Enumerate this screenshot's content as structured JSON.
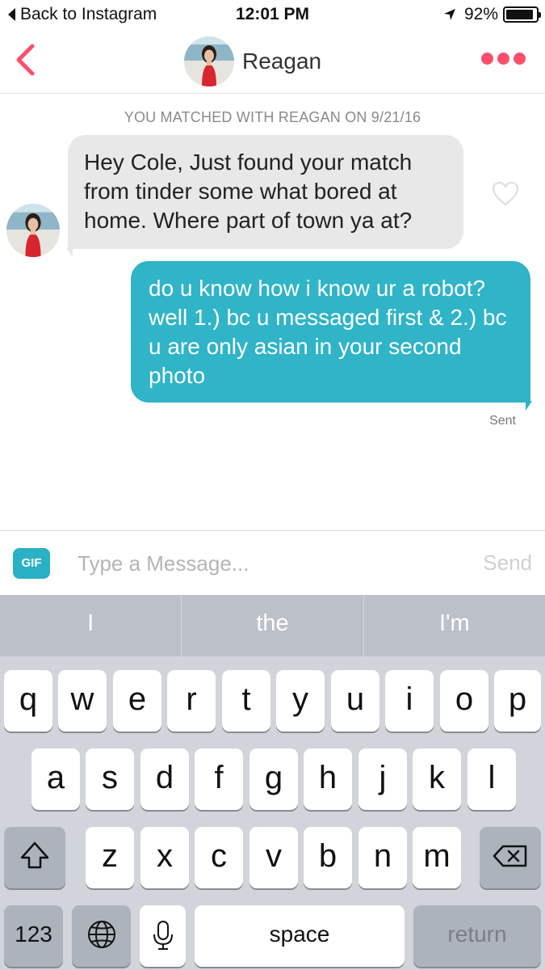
{
  "status_bar": {
    "back_label": "Back to Instagram",
    "time": "12:01 PM",
    "battery": "92%",
    "battery_fraction": 0.92
  },
  "header": {
    "name": "Reagan",
    "back_icon": "chevron-left-icon",
    "more_icon": "more-dots-icon",
    "accent_color": "#fd4f6a"
  },
  "chat": {
    "match_note": "YOU MATCHED WITH REAGAN ON 9/21/16",
    "messages": [
      {
        "from": "them",
        "text": "Hey Cole,  Just found your match from tinder some what bored at home. Where part of town ya at?"
      },
      {
        "from": "me",
        "text": "do u know how i know ur a robot? well 1.) bc u messaged first & 2.) bc u are only asian in your second photo"
      }
    ],
    "sent_label": "Sent",
    "outgoing_color": "#2fb4c8"
  },
  "composer": {
    "gif_label": "GIF",
    "placeholder": "Type a Message...",
    "send_label": "Send"
  },
  "keyboard": {
    "suggestions": [
      "I",
      "the",
      "I'm"
    ],
    "rows": [
      [
        "q",
        "w",
        "e",
        "r",
        "t",
        "y",
        "u",
        "i",
        "o",
        "p"
      ],
      [
        "a",
        "s",
        "d",
        "f",
        "g",
        "h",
        "j",
        "k",
        "l"
      ],
      [
        "z",
        "x",
        "c",
        "v",
        "b",
        "n",
        "m"
      ]
    ],
    "numbers_label": "123",
    "space_label": "space",
    "return_label": "return"
  }
}
